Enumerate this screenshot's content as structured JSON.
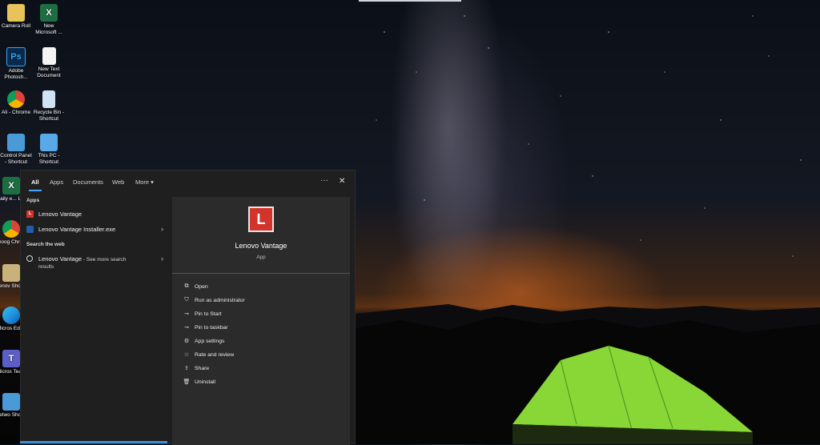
{
  "desktop": {
    "icons": [
      {
        "label": "Camera Roll",
        "icon": "folder-icon",
        "color": "#e7c35a",
        "glyph": ""
      },
      {
        "label": "New Microsoft ...",
        "icon": "excel-icon",
        "color": "#1d6f42",
        "glyph": "X"
      },
      {
        "label": "Adobe Photosh...",
        "icon": "photoshop-icon",
        "color": "#0b2a4a",
        "glyph": "Ps"
      },
      {
        "label": "New Text Document",
        "icon": "text-document-icon",
        "color": "#f4f4f4",
        "glyph": ""
      },
      {
        "label": "Ali - Chrome",
        "icon": "chrome-icon",
        "color": "#db4437",
        "glyph": ""
      },
      {
        "label": "Recycle Bin - Shortcut",
        "icon": "recycle-bin-icon",
        "color": "#cfe3f5",
        "glyph": ""
      },
      {
        "label": "Control Panel - Shortcut",
        "icon": "control-panel-icon",
        "color": "#4a9ad8",
        "glyph": ""
      },
      {
        "label": "This PC - Shortcut",
        "icon": "this-pc-icon",
        "color": "#59a8e8",
        "glyph": ""
      },
      {
        "label": "Daily e... List",
        "icon": "excel-icon",
        "color": "#1d6f42",
        "glyph": "X"
      },
      {
        "label": "Goog Chron",
        "icon": "chrome-icon",
        "color": "#db4437",
        "glyph": ""
      },
      {
        "label": "Lenov Shortc",
        "icon": "lenovo-shortcut-icon",
        "color": "#c8b27a",
        "glyph": ""
      },
      {
        "label": "Micros Edge",
        "icon": "edge-icon",
        "color": "#1f8ad8",
        "glyph": ""
      },
      {
        "label": "Micros Team",
        "icon": "teams-icon",
        "color": "#5b5fc7",
        "glyph": "T"
      },
      {
        "label": "Netwo Shortc",
        "icon": "network-icon",
        "color": "#4a9ad8",
        "glyph": ""
      }
    ]
  },
  "search": {
    "tabs": [
      {
        "label": "All",
        "active": true
      },
      {
        "label": "Apps",
        "active": false
      },
      {
        "label": "Documents",
        "active": false
      },
      {
        "label": "Web",
        "active": false
      },
      {
        "label": "More ▾",
        "active": false
      }
    ],
    "more_options": "···",
    "close": "✕",
    "sections": {
      "apps_title": "Apps",
      "web_title": "Search the web"
    },
    "results": {
      "app1": "Lenovo Vantage",
      "app2": "Lenovo Vantage Installer.exe",
      "web_query": "Lenovo Vantage",
      "web_suffix": " - See more search",
      "web_suffix2": "results",
      "chevron": "›"
    },
    "detail": {
      "icon_letter": "L",
      "app_name": "Lenovo Vantage",
      "app_type": "App",
      "actions": [
        {
          "label": "Open",
          "icon": "open-icon",
          "glyph": "⧉"
        },
        {
          "label": "Run as administrator",
          "icon": "shield-icon",
          "glyph": "⛉"
        },
        {
          "label": "Pin to Start",
          "icon": "pin-icon",
          "glyph": "⊸"
        },
        {
          "label": "Pin to taskbar",
          "icon": "pin-icon",
          "glyph": "⊸"
        },
        {
          "label": "App settings",
          "icon": "gear-icon",
          "glyph": "⚙"
        },
        {
          "label": "Rate and review",
          "icon": "star-icon",
          "glyph": "☆"
        },
        {
          "label": "Share",
          "icon": "share-icon",
          "glyph": "⇪"
        },
        {
          "label": "Uninstall",
          "icon": "trash-icon",
          "glyph": "🗑"
        }
      ]
    }
  }
}
